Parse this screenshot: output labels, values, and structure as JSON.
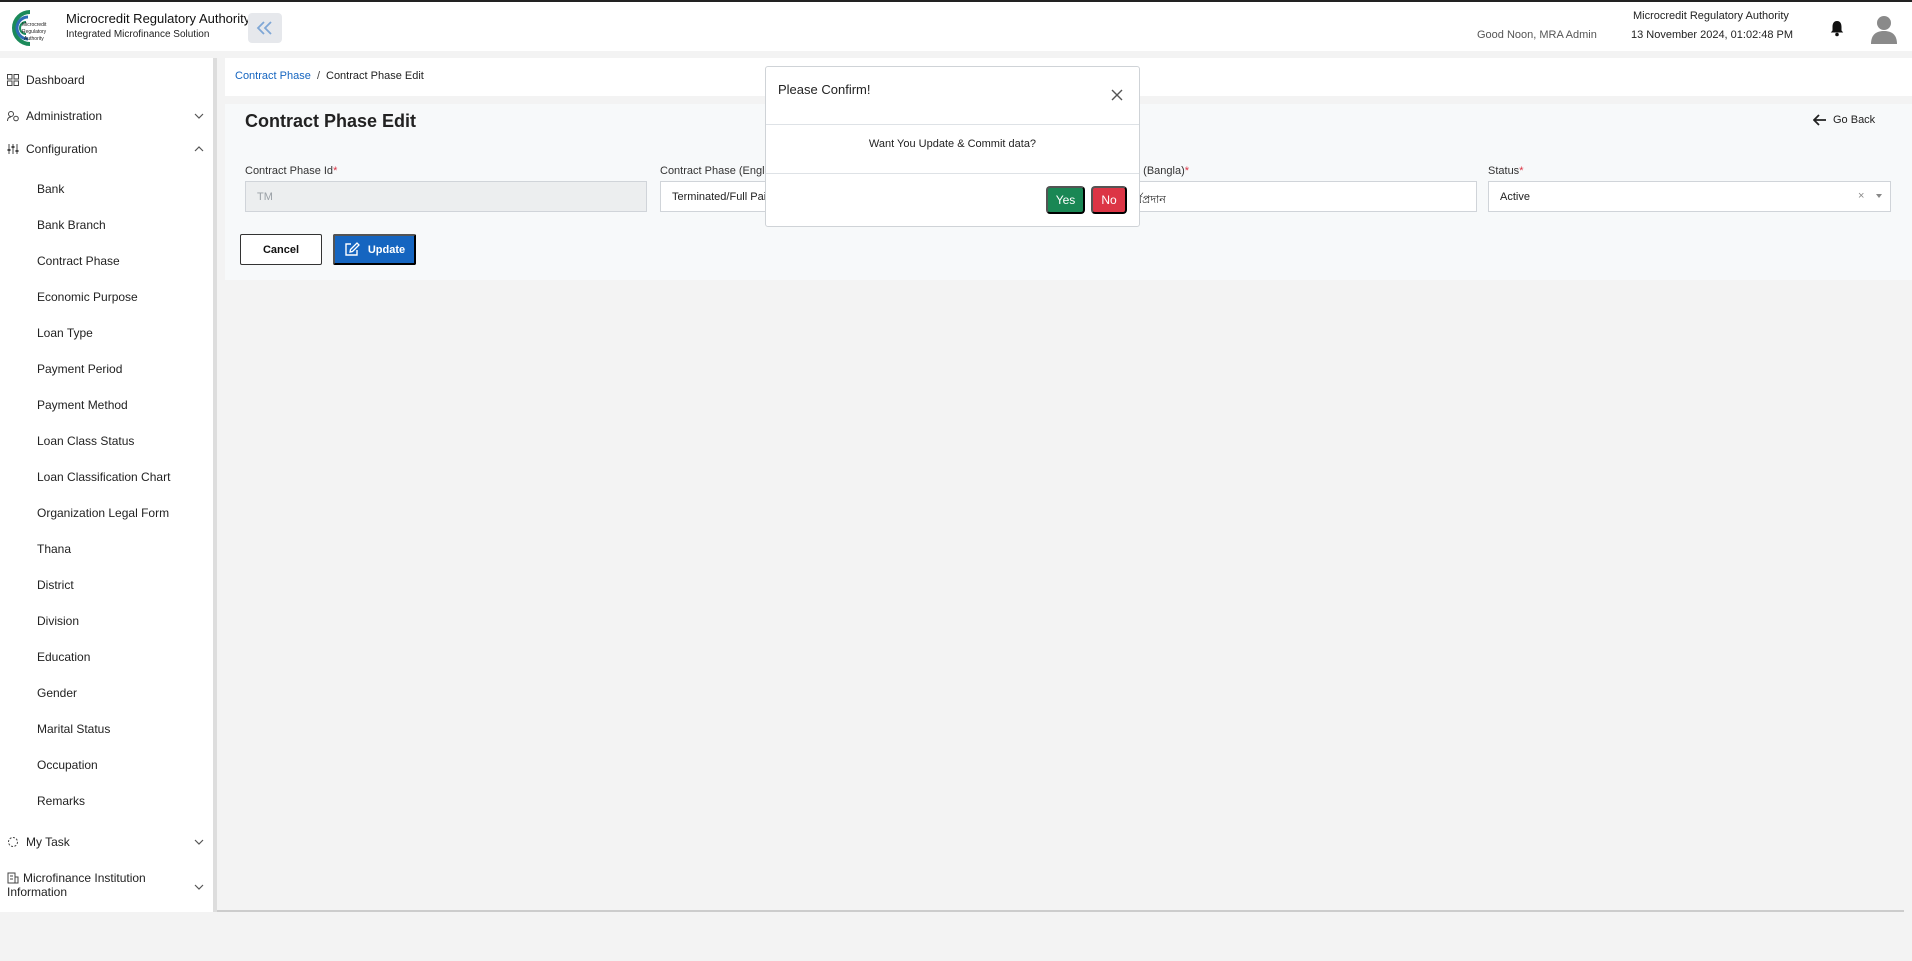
{
  "header": {
    "logo_text": "Microcredit Regulatory Authority",
    "brand_title": "Microcredit Regulatory Authority",
    "brand_subtitle": "Integrated Microfinance Solution",
    "greeting": "Good Noon, MRA Admin",
    "org_name": "Microcredit Regulatory Authority",
    "datetime": "13 November 2024, 01:02:48 PM",
    "icons": [
      "collapse-sidebar-icon",
      "bell-icon",
      "user-avatar-icon"
    ]
  },
  "sidebar": {
    "dashboard": "Dashboard",
    "administration": "Administration",
    "configuration": "Configuration",
    "config_items": [
      "Bank",
      "Bank Branch",
      "Contract Phase",
      "Economic Purpose",
      "Loan Type",
      "Payment Period",
      "Payment Method",
      "Loan Class Status",
      "Loan Classification Chart",
      "Organization Legal Form",
      "Thana",
      "District",
      "Division",
      "Education",
      "Gender",
      "Marital Status",
      "Occupation",
      "Remarks"
    ],
    "my_task": "My Task",
    "mfi_info": "Microfinance Institution Information"
  },
  "breadcrumb": {
    "parent": "Contract Phase",
    "separator": "/",
    "current": "Contract Phase Edit"
  },
  "page": {
    "title": "Contract Phase Edit",
    "go_back": "Go Back"
  },
  "form": {
    "id_label": "Contract Phase Id",
    "id_value": "TM",
    "english_label": "Contract Phase (Englis",
    "english_value": "Terminated/Full Paid",
    "bangla_label": "e (Bangla)",
    "bangla_value": "র্থপ্রদান",
    "status_label": "Status",
    "status_value": "Active",
    "required_mark": "*",
    "clear_symbol": "×",
    "cancel_label": "Cancel",
    "update_label": "Update"
  },
  "modal": {
    "title": "Please Confirm!",
    "message": "Want You Update & Commit data?",
    "yes_label": "Yes",
    "no_label": "No"
  },
  "colors": {
    "primary": "#1565c0",
    "success": "#198754",
    "danger": "#dc3545"
  }
}
